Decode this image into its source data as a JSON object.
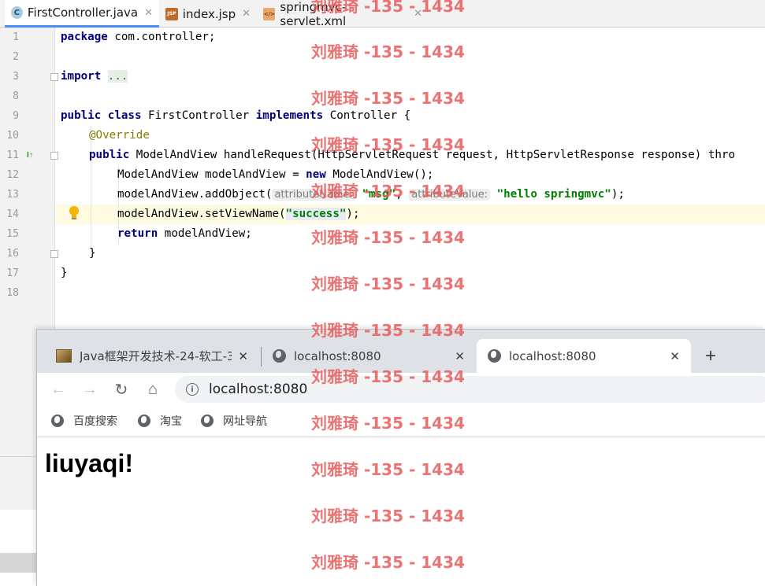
{
  "ide": {
    "tabs": [
      {
        "label": "FirstController.java",
        "icon": "java-class-icon"
      },
      {
        "label": "index.jsp",
        "icon": "jsp-file-icon"
      },
      {
        "label": "springmvc-servlet.xml",
        "icon": "xml-file-icon"
      }
    ],
    "line_numbers": [
      "1",
      "2",
      "3",
      "8",
      "9",
      "10",
      "11",
      "12",
      "13",
      "14",
      "15",
      "16",
      "17",
      "18"
    ],
    "code": {
      "l1_kw": "package",
      "l1_rest": " com.controller;",
      "l3_kw": "import",
      "l3_fold": "...",
      "l9_kw1": "public",
      "l9_kw2": "class",
      "l9_name": " FirstController ",
      "l9_kw3": "implements",
      "l9_rest": " Controller {",
      "l10_ann": "@Override",
      "l11_kw": "public",
      "l11_rest": " ModelAndView handleRequest(HttpServletRequest request, HttpServletResponse response) thro",
      "l12_a": "ModelAndView modelAndView = ",
      "l12_kw": "new",
      "l12_b": " ModelAndView();",
      "l13_a": "modelAndView.addObject(",
      "l13_hint1": "attributeName:",
      "l13_str1": "\"msg\"",
      "l13_comma": ", ",
      "l13_hint2": "attributeValue:",
      "l13_str2": "\"hello springmvc\"",
      "l13_end": ");",
      "l14_a": "modelAndView.setViewName(",
      "l14_str": "\"success\"",
      "l14_end": ");",
      "l15_kw": "return",
      "l15_rest": " modelAndView;",
      "l16": "}",
      "l17": "}"
    }
  },
  "browser": {
    "tabs": [
      {
        "title": "Java框架开发技术-24-软工-3",
        "close": "✕"
      },
      {
        "title": "localhost:8080",
        "close": "✕"
      },
      {
        "title": "localhost:8080",
        "close": "✕"
      }
    ],
    "new_tab": "+",
    "url": "localhost:8080",
    "bookmarks": [
      "百度搜索",
      "淘宝",
      "网址导航"
    ],
    "page_heading": "liuyaqi!"
  },
  "watermark": "刘雅琦 -135 - 1434"
}
